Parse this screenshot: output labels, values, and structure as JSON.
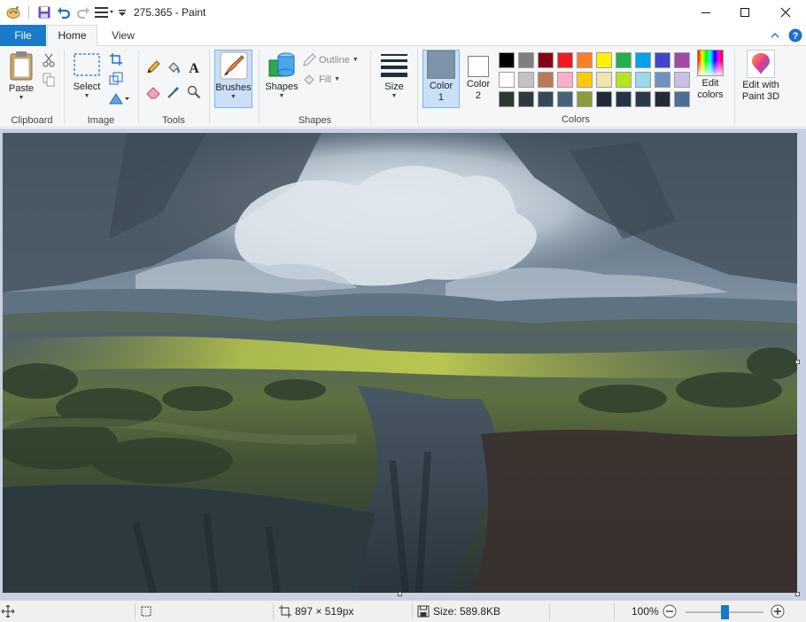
{
  "window": {
    "title": "275.365 - Paint",
    "minimize_glyph": "–",
    "maximize_glyph": "☐",
    "close_glyph": "✕"
  },
  "tabs": {
    "file": "File",
    "home": "Home",
    "view": "View"
  },
  "ribbon": {
    "clipboard": {
      "paste": "Paste",
      "group": "Clipboard"
    },
    "image": {
      "select": "Select",
      "group": "Image"
    },
    "tools": {
      "group": "Tools"
    },
    "brushes": "Brushes",
    "shapes": {
      "shapes": "Shapes",
      "outline": "Outline",
      "fill": "Fill",
      "group": "Shapes"
    },
    "size": "Size",
    "colors": {
      "color1_line1": "Color",
      "color1_line2": "1",
      "color2_line1": "Color",
      "color2_line2": "2",
      "edit_line1": "Edit",
      "edit_line2": "colors",
      "group": "Colors",
      "color1_value": "#7b93ab",
      "color2_value": "#ffffff",
      "palette": [
        [
          "#000000",
          "#7f7f7f",
          "#880015",
          "#ed1c24",
          "#ff7f27",
          "#fff200",
          "#22b14c",
          "#00a2e8",
          "#3f48cc",
          "#a349a4"
        ],
        [
          "#ffffff",
          "#c3c3c3",
          "#b97a57",
          "#ffaec9",
          "#ffc90e",
          "#efe4b0",
          "#b5e61d",
          "#99d9ea",
          "#7092be",
          "#c8bfe7"
        ],
        [
          "#2b3a2e",
          "#2c3b3f",
          "#34495a",
          "#46637a",
          "#8a9c3c",
          "#1f2a36",
          "#243444",
          "#2a3a4a",
          "#222c36",
          "#4e6f94"
        ]
      ]
    },
    "paint3d_line1": "Edit with",
    "paint3d_line2": "Paint 3D"
  },
  "status": {
    "dimensions": "897 × 519px",
    "size": "Size: 589.8KB",
    "zoom": "100%",
    "zoom_minus": "−",
    "zoom_plus": "+",
    "zoom_level": 0.5
  },
  "icons": {
    "paint-icon": "🎨",
    "help-icon": "?",
    "collapse-icon": "^"
  },
  "accent": "#1979ca"
}
